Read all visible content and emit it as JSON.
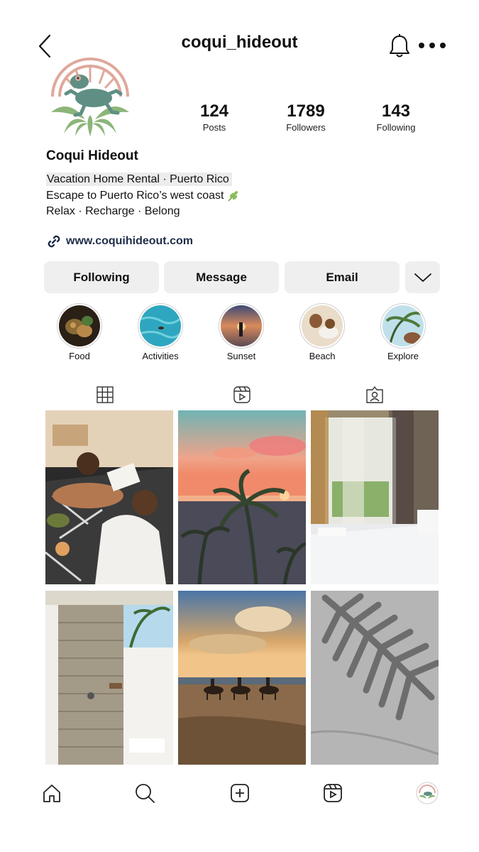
{
  "profile": {
    "username": "coqui_hideout",
    "display_name": "Coqui Hideout",
    "bio_category": "Vacation Home Rental · Puerto Rico",
    "bio_line2": "Escape to Puerto Rico’s west coast",
    "bio_line3": "Relax · Recharge · Belong",
    "website": "www.coquihideout.com"
  },
  "stats": [
    {
      "value": "124",
      "label": "Posts"
    },
    {
      "value": "1789",
      "label": "Followers"
    },
    {
      "value": "143",
      "label": "Following"
    }
  ],
  "actions": {
    "following_label": "Following",
    "message_label": "Message",
    "email_label": "Email"
  },
  "highlights": [
    {
      "label": "Food"
    },
    {
      "label": "Activities"
    },
    {
      "label": "Sunset"
    },
    {
      "label": "Beach"
    },
    {
      "label": "Explore"
    }
  ],
  "tabs": [
    {
      "icon": "grid-icon"
    },
    {
      "icon": "reels-icon"
    },
    {
      "icon": "tagged-icon"
    }
  ],
  "nav": [
    {
      "icon": "home-icon"
    },
    {
      "icon": "search-icon"
    },
    {
      "icon": "create-icon"
    },
    {
      "icon": "reels-icon"
    },
    {
      "icon": "profile-avatar"
    }
  ],
  "colors": {
    "button_bg": "#efefef",
    "link": "#1f2d4a",
    "logo_sun": "#e0a89c",
    "logo_frog": "#5f8f84"
  }
}
